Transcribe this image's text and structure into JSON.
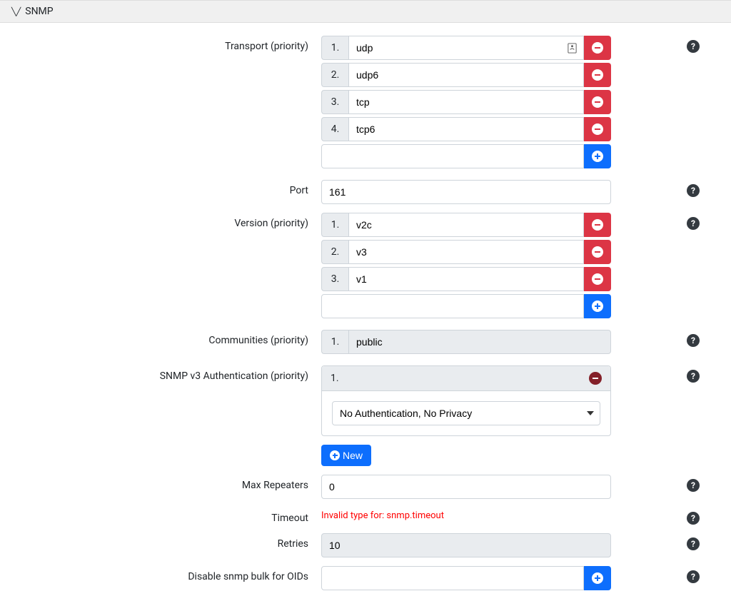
{
  "header": {
    "title": "SNMP"
  },
  "transport": {
    "label": "Transport (priority)",
    "items": [
      {
        "num": "1.",
        "value": "udp"
      },
      {
        "num": "2.",
        "value": "udp6"
      },
      {
        "num": "3.",
        "value": "tcp"
      },
      {
        "num": "4.",
        "value": "tcp6"
      }
    ]
  },
  "port": {
    "label": "Port",
    "value": "161"
  },
  "version": {
    "label": "Version (priority)",
    "items": [
      {
        "num": "1.",
        "value": "v2c"
      },
      {
        "num": "2.",
        "value": "v3"
      },
      {
        "num": "3.",
        "value": "v1"
      }
    ]
  },
  "communities": {
    "label": "Communities (priority)",
    "items": [
      {
        "num": "1.",
        "value": "public"
      }
    ]
  },
  "auth": {
    "label": "SNMP v3 Authentication (priority)",
    "items": [
      {
        "num": "1.",
        "select_value": "No Authentication, No Privacy"
      }
    ],
    "new_label": "New"
  },
  "max_repeaters": {
    "label": "Max Repeaters",
    "value": "0"
  },
  "timeout": {
    "label": "Timeout",
    "error": "Invalid type for: snmp.timeout"
  },
  "retries": {
    "label": "Retries",
    "value": "10"
  },
  "disable_bulk": {
    "label": "Disable snmp bulk for OIDs"
  }
}
